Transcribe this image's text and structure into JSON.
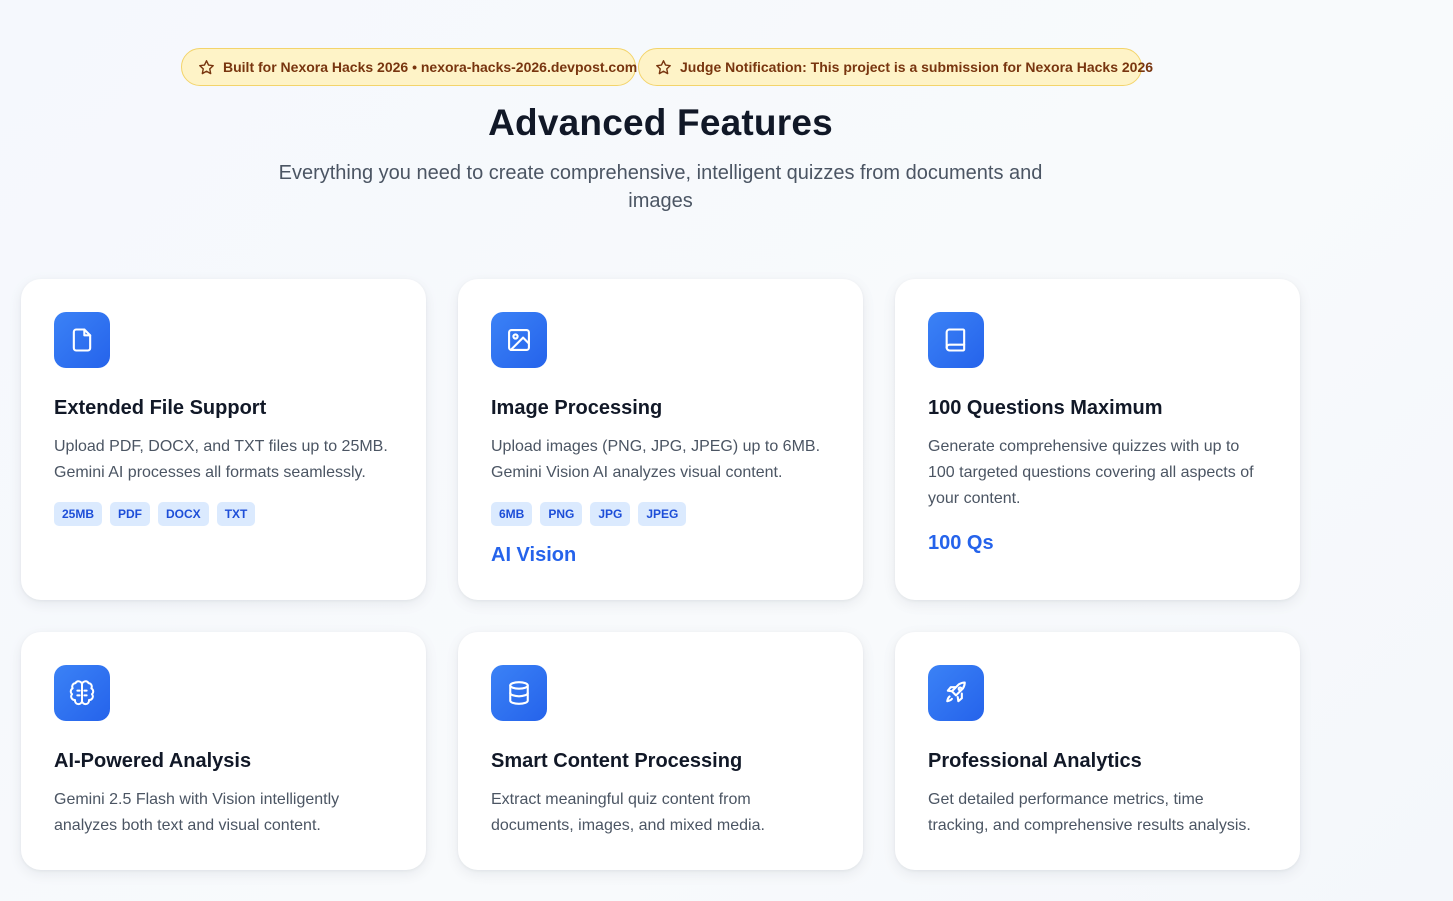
{
  "banners": [
    {
      "icon": "star-icon",
      "text": "Built for Nexora Hacks 2026 • nexora-hacks-2026.devpost.com"
    },
    {
      "icon": "star-icon",
      "text": "Judge Notification: This project is a submission for Nexora Hacks 2026"
    }
  ],
  "header": {
    "title": "Advanced Features",
    "subtitle": "Everything you need to create comprehensive, intelligent quizzes from documents and images"
  },
  "colors": {
    "accent": "#2563eb",
    "icon_bg": "#3b82f6",
    "tag_bg": "#dbeafe",
    "banner_bg": "#fef3c7"
  },
  "features": [
    {
      "icon": "file-icon",
      "title": "Extended File Support",
      "description": "Upload PDF, DOCX, and TXT files up to 25MB. Gemini AI processes all formats seamlessly.",
      "tags": [
        "25MB",
        "PDF",
        "DOCX",
        "TXT"
      ]
    },
    {
      "icon": "image-icon",
      "title": "Image Processing",
      "description": "Upload images (PNG, JPG, JPEG) up to 6MB. Gemini Vision AI analyzes visual content.",
      "tags": [
        "6MB",
        "PNG",
        "JPG",
        "JPEG"
      ],
      "highlight": "AI Vision"
    },
    {
      "icon": "book-icon",
      "title": "100 Questions Maximum",
      "description": "Generate comprehensive quizzes with up to 100 targeted questions covering all aspects of your content.",
      "highlight": "100 Qs"
    },
    {
      "icon": "brain-icon",
      "title": "AI-Powered Analysis",
      "description": "Gemini 2.5 Flash with Vision intelligently analyzes both text and visual content."
    },
    {
      "icon": "database-icon",
      "title": "Smart Content Processing",
      "description": "Extract meaningful quiz content from documents, images, and mixed media."
    },
    {
      "icon": "rocket-icon",
      "title": "Professional Analytics",
      "description": "Get detailed performance metrics, time tracking, and comprehensive results analysis."
    }
  ]
}
